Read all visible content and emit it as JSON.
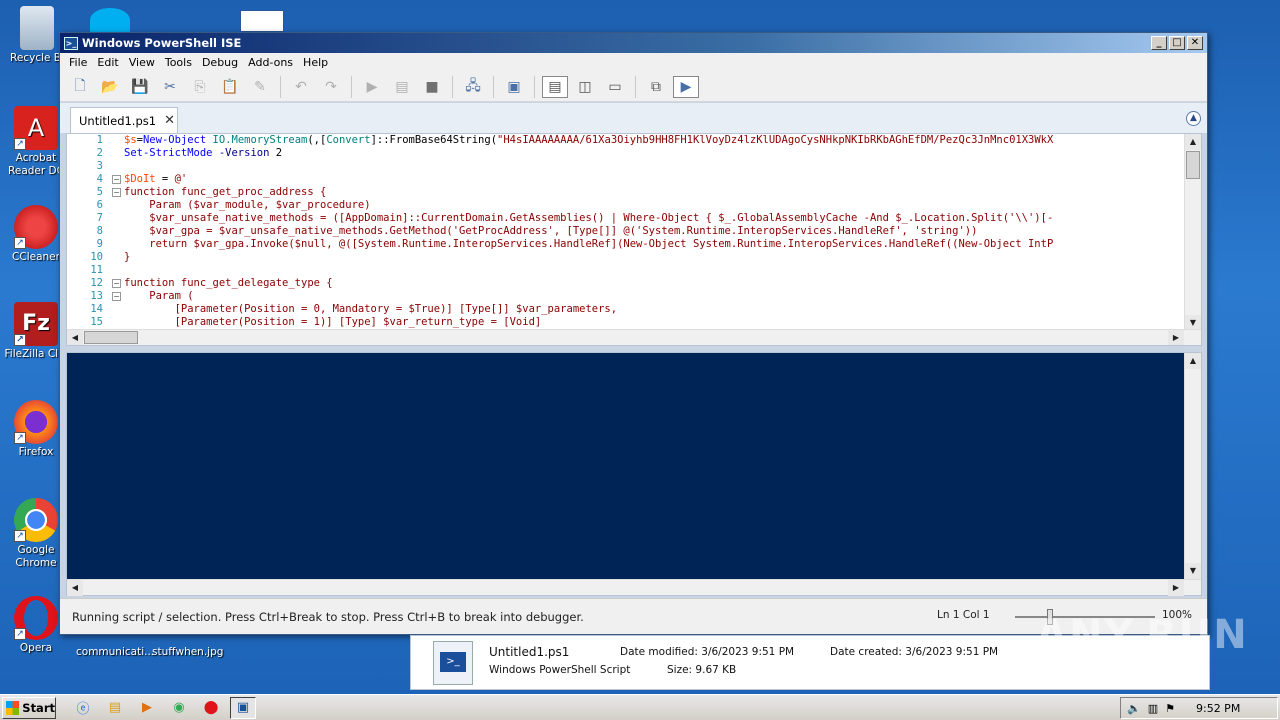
{
  "desktop": {
    "icons": [
      {
        "label": "Recycle Bi",
        "icon": "recycle-bin-icon"
      },
      {
        "label": "Acrobat Reader DC",
        "icon": "acrobat-icon"
      },
      {
        "label": "CCleaner",
        "icon": "ccleaner-icon"
      },
      {
        "label": "FileZilla Clie",
        "icon": "filezilla-icon"
      },
      {
        "label": "Firefox",
        "icon": "firefox-icon"
      },
      {
        "label": "Google Chrome",
        "icon": "chrome-icon"
      },
      {
        "label": "Opera",
        "icon": "opera-icon"
      }
    ],
    "bottom_labels": [
      "communicati...",
      "stuffwhen.jpg"
    ]
  },
  "window": {
    "title": "Windows PowerShell ISE",
    "menu": [
      "File",
      "Edit",
      "View",
      "Tools",
      "Debug",
      "Add-ons",
      "Help"
    ],
    "tab": {
      "label": "Untitled1.ps1",
      "close": "✕"
    },
    "line_numbers": [
      "1",
      "2",
      "3",
      "4",
      "5",
      "6",
      "7",
      "8",
      "9",
      "10",
      "11",
      "12",
      "13",
      "14",
      "15"
    ],
    "status": {
      "message": "Running script / selection.  Press Ctrl+Break to stop.  Press Ctrl+B to break into debugger.",
      "position": "Ln 1  Col 1",
      "zoom": "100%",
      "zoom_level": 0.25
    }
  },
  "details": {
    "filename": "Untitled1.ps1",
    "filetype": "Windows PowerShell Script",
    "date_modified": "Date modified: 3/6/2023 9:51 PM",
    "date_created": "Date created: 3/6/2023 9:51 PM",
    "size": "Size: 9.67 KB"
  },
  "watermark": "ANY.RUN",
  "taskbar": {
    "start_label": "Start",
    "clock": "9:52 PM"
  }
}
